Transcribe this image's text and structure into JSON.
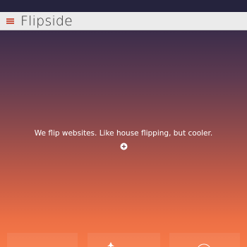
{
  "header": {
    "brand": "Flipside",
    "menu_icon": "hamburger-menu-icon"
  },
  "hero": {
    "tagline": "We flip websites. Like house flipping, but cooler.",
    "expand_icon": "plus-circle-icon"
  },
  "cards": [
    {
      "icon": "none"
    },
    {
      "icon": "bird-icon"
    },
    {
      "icon": "circle-icon"
    }
  ],
  "colors": {
    "gradient_top": "#2a2542",
    "gradient_bottom": "#f77a48",
    "header_bg": "#ebebeb",
    "accent": "#c9523f"
  }
}
